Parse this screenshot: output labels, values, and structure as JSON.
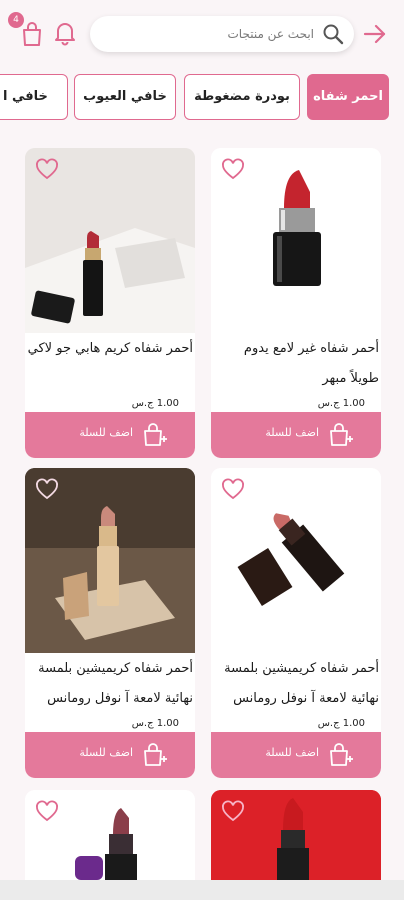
{
  "header": {
    "cart_count": "4",
    "search_placeholder": "ابحث عن منتجات"
  },
  "categories": [
    {
      "label": "احمر شفاه",
      "active": true
    },
    {
      "label": "بودرة مضغوطة",
      "active": false
    },
    {
      "label": "خافي العيوب",
      "active": false
    },
    {
      "label": "خافي ا",
      "active": false
    }
  ],
  "products": [
    {
      "name": "أحمر شفاه غير لامع يدوم طويلاً مبهر",
      "price": "1.00 ج.س",
      "add_label": "اضف للسلة"
    },
    {
      "name": "أحمر شفاه كريم هابي جو لاكي",
      "price": "1.00 ج.س",
      "add_label": "اضف للسلة"
    },
    {
      "name": "أحمر شفاه كريميشين بلمسة نهائية لامعة آ نوفل رومانس",
      "price": "1.00 ج.س",
      "add_label": "اضف للسلة"
    },
    {
      "name": "أحمر شفاه كريميشين بلمسة نهائية لامعة آ نوفل رومانس",
      "price": "1.00 ج.س",
      "add_label": "اضف للسلة"
    },
    {
      "name": "",
      "price": "",
      "add_label": ""
    },
    {
      "name": "",
      "price": "",
      "add_label": ""
    }
  ],
  "colors": {
    "accent": "#e0698f",
    "button": "#e4799b"
  }
}
